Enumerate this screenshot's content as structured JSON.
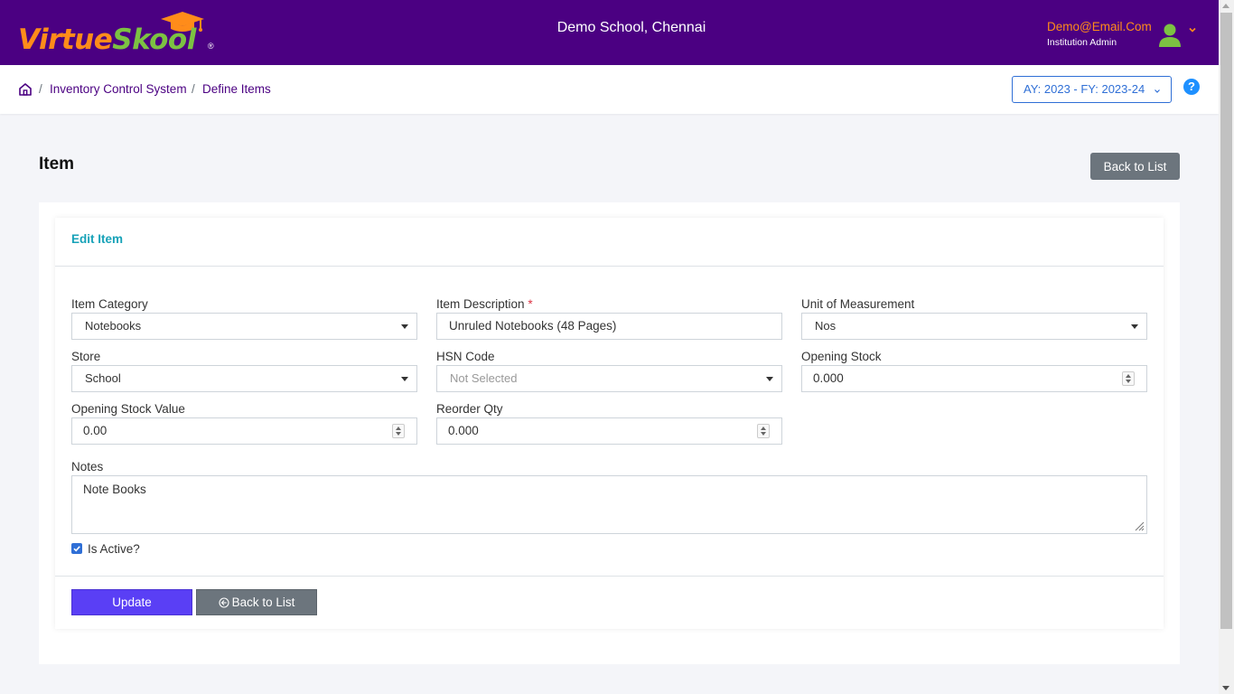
{
  "header": {
    "logo": {
      "part1": "Virtue",
      "part2": "Sk",
      "part3": "ool",
      "reg": "®"
    },
    "school_name": "Demo School, Chennai",
    "user_email": "Demo@Email.Com",
    "user_role": "Institution Admin"
  },
  "breadcrumb": {
    "items": [
      "Inventory Control System",
      "Define Items"
    ],
    "separator": "/"
  },
  "academic_year": {
    "selected": "AY: 2023 - FY: 2023-24"
  },
  "help": {
    "label": "?"
  },
  "page": {
    "title": "Item",
    "back_to_list_label": "Back to List"
  },
  "form": {
    "card_title": "Edit Item",
    "item_category": {
      "label": "Item Category",
      "value": "Notebooks"
    },
    "item_description": {
      "label": "Item Description",
      "required_mark": "*",
      "value": "Unruled Notebooks (48 Pages)"
    },
    "unit_of_measurement": {
      "label": "Unit of Measurement",
      "value": "Nos"
    },
    "store": {
      "label": "Store",
      "value": "School"
    },
    "hsn_code": {
      "label": "HSN Code",
      "placeholder": "Not Selected"
    },
    "opening_stock": {
      "label": "Opening Stock",
      "value": "0.000"
    },
    "opening_stock_value": {
      "label": "Opening Stock Value",
      "value": "0.00"
    },
    "reorder_qty": {
      "label": "Reorder Qty",
      "value": "0.000"
    },
    "notes": {
      "label": "Notes",
      "value": "Note Books"
    },
    "is_active": {
      "label": "Is Active?",
      "checked": true
    },
    "update_label": "Update",
    "back_to_list_label": "Back to List"
  },
  "colors": {
    "header_bg": "#4b0082",
    "logo_orange": "#ff8c1a",
    "logo_green": "#7cc242",
    "accent_blue": "#2f6fd6",
    "update_button": "#5a3ff5",
    "secondary_button": "#6c757d",
    "card_title": "#17a2b8"
  },
  "icons": [
    "graduation-cap-icon",
    "user-avatar-icon",
    "chevron-down-icon",
    "home-icon",
    "help-icon",
    "caret-down-icon",
    "spinner-icon",
    "check-icon",
    "back-arrow-circle-icon",
    "resize-grip-icon"
  ]
}
